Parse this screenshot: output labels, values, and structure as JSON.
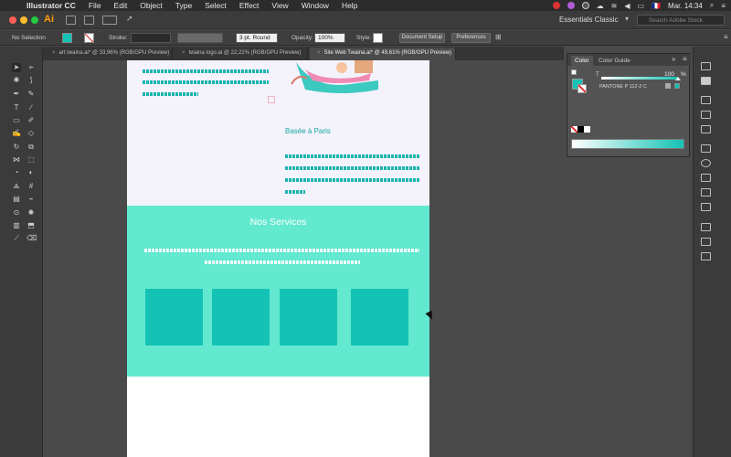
{
  "menubar": {
    "app_name": "Illustrator CC",
    "items": [
      "File",
      "Edit",
      "Object",
      "Type",
      "Select",
      "Effect",
      "View",
      "Window",
      "Help"
    ],
    "flag": "🇫🇷",
    "clock": "Mar. 14:34"
  },
  "appbar": {
    "logo": "Ai",
    "workspace": "Essentials Classic",
    "search_placeholder": "Search Adobe Stock"
  },
  "controlbar": {
    "selection_label": "No Selection",
    "stroke_label": "Stroke:",
    "stroke_profile": "3 pt. Round",
    "opacity_label": "Opacity:",
    "opacity_value": "100%",
    "style_label": "Style:",
    "document_setup": "Document Setup",
    "preferences": "Preferences"
  },
  "tabs": [
    {
      "label": "art twaina.ai* @ 33,96% (RGB/GPU Preview)",
      "active": false
    },
    {
      "label": "twaina logo.ai @ 22,22% (RGB/GPU Preview)",
      "active": false
    },
    {
      "label": "Site Web Twaina.ai* @ 49,61% (RGB/GPU Preview)",
      "active": true
    }
  ],
  "artboard": {
    "subtitle": "Basée à Paris",
    "services_title": "Nos Services"
  },
  "color_panel": {
    "tabs": [
      "Color",
      "Color Guide"
    ],
    "channel_label": "T",
    "tint_value": "100",
    "percent": "%",
    "swatch_name": "PANTONE P 112-2 C"
  },
  "colors": {
    "accent": "#14c3b5",
    "services_bg": "#62e9cf",
    "artboard_top_bg": "#f4f2fb",
    "text_teal": "#1ab4ad"
  }
}
